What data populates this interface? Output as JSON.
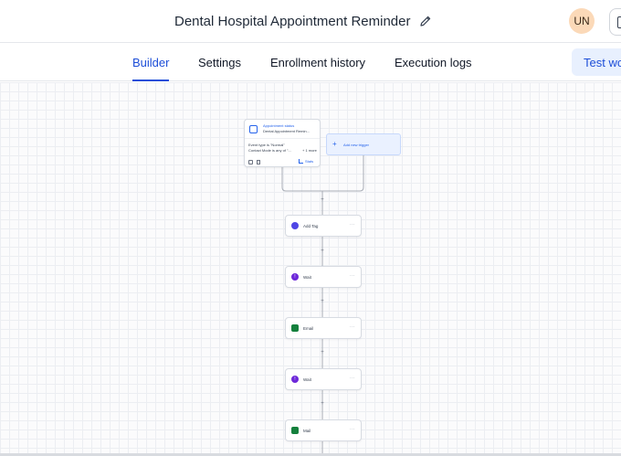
{
  "header": {
    "title": "Dental Hospital Appointment Reminder",
    "avatar_initials": "UN",
    "edit_icon": "pencil-icon",
    "extra_icon": "panel-icon"
  },
  "tabs": [
    {
      "label": "Builder",
      "active": true
    },
    {
      "label": "Settings",
      "active": false
    },
    {
      "label": "Enrollment history",
      "active": false
    },
    {
      "label": "Execution logs",
      "active": false
    }
  ],
  "actions": {
    "test_label": "Test wo"
  },
  "workflow": {
    "trigger": {
      "title": "Appointment status",
      "subtitle": "Dental Appointment Remin...",
      "conditions": [
        "Event type is \"Normal\"",
        "Contact Mode is any of \"...",
        "+ 1 more"
      ],
      "stats_label": "Stats"
    },
    "add_trigger_label": "Add new trigger",
    "nodes": [
      {
        "label": "Add Tag",
        "icon": "tag-icon",
        "color": "#4f46e5"
      },
      {
        "label": "Wait",
        "icon": "clock-icon",
        "color": "#6d28d9"
      },
      {
        "label": "Email",
        "icon": "email-icon",
        "color": "#15803d"
      },
      {
        "label": "Wait",
        "icon": "clock-icon",
        "color": "#6d28d9"
      },
      {
        "label": "Mail",
        "icon": "mail-icon",
        "color": "#15803d"
      }
    ],
    "colors": {
      "accent": "#1d4ed8",
      "connector": "#a8adb6"
    }
  }
}
